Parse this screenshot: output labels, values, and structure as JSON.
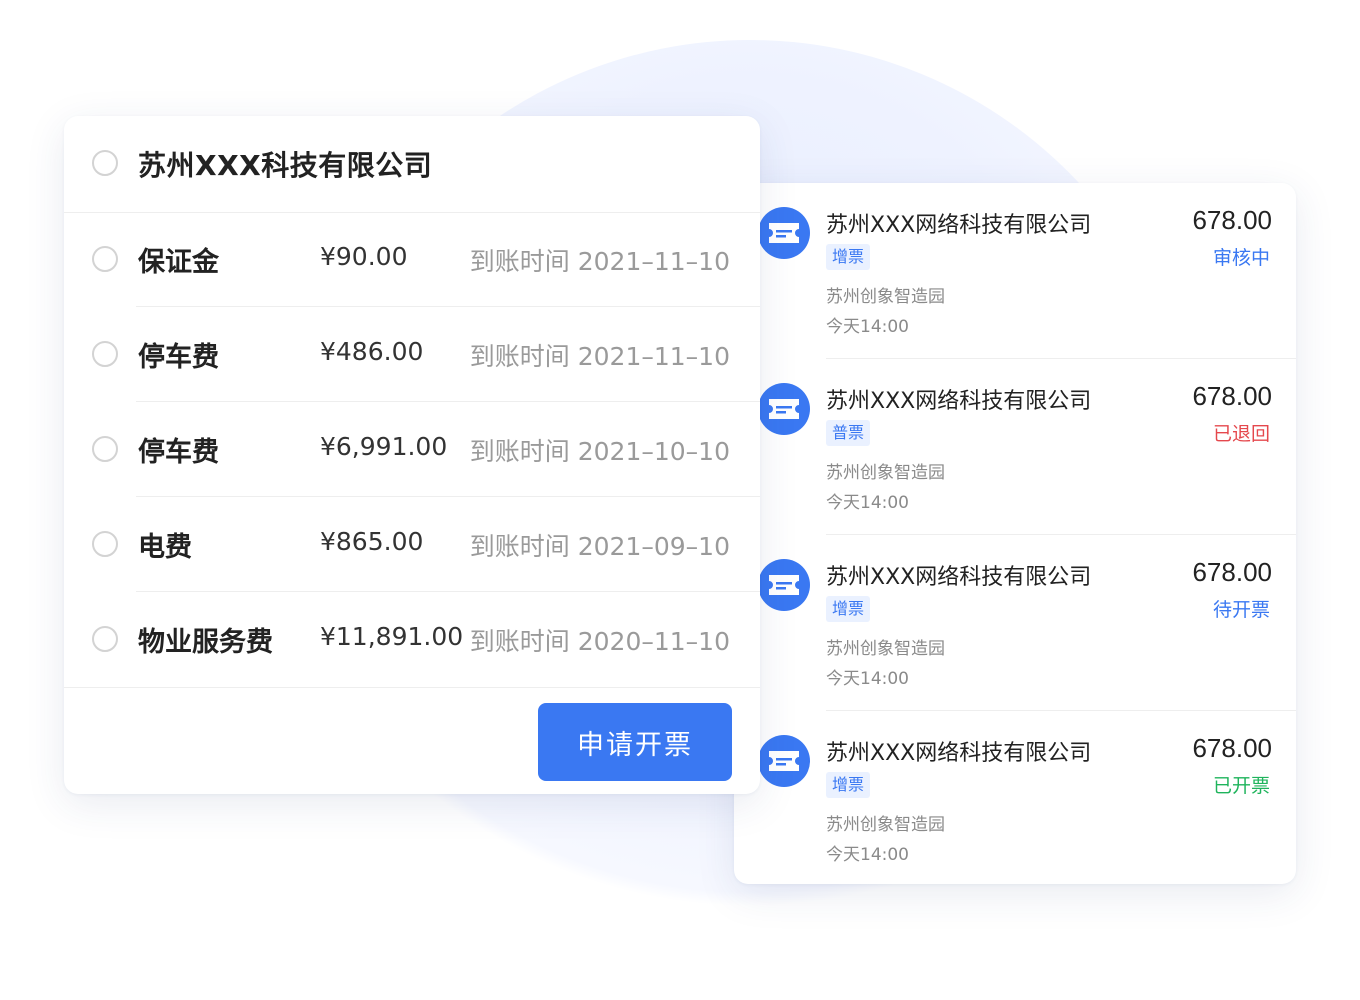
{
  "colors": {
    "primary": "#3a78f2",
    "status_reviewing": "#3a78f2",
    "status_returned": "#e5484d",
    "status_pending": "#3a78f2",
    "status_issued": "#1fb45c"
  },
  "left_card": {
    "company": "苏州XXX科技有限公司",
    "fees": [
      {
        "name": "保证金",
        "amount": "¥90.00",
        "date": "到账时间  2021–11–10"
      },
      {
        "name": "停车费",
        "amount": "¥486.00",
        "date": "到账时间  2021–11–10"
      },
      {
        "name": "停车费",
        "amount": "¥6,991.00",
        "date": "到账时间  2021–10–10"
      },
      {
        "name": "电费",
        "amount": "¥865.00",
        "date": "到账时间  2021–09–10"
      },
      {
        "name": "物业服务费",
        "amount": "¥11,891.00",
        "date": "到账时间  2020–11–10"
      }
    ],
    "apply_button": "申请开票"
  },
  "invoices": [
    {
      "icon": "ticket-icon",
      "company": "苏州XXX网络科技有限公司",
      "tag": "增票",
      "location": "苏州创象智造园",
      "time": "今天14:00",
      "amount": "678.00",
      "status": "审核中",
      "status_color": "#3a78f2"
    },
    {
      "icon": "ticket-icon",
      "company": "苏州XXX网络科技有限公司",
      "tag": "普票",
      "location": "苏州创象智造园",
      "time": "今天14:00",
      "amount": "678.00",
      "status": "已退回",
      "status_color": "#e5484d"
    },
    {
      "icon": "ticket-icon",
      "company": "苏州XXX网络科技有限公司",
      "tag": "增票",
      "location": "苏州创象智造园",
      "time": "今天14:00",
      "amount": "678.00",
      "status": "待开票",
      "status_color": "#3a78f2"
    },
    {
      "icon": "ticket-icon",
      "company": "苏州XXX网络科技有限公司",
      "tag": "增票",
      "location": "苏州创象智造园",
      "time": "今天14:00",
      "amount": "678.00",
      "status": "已开票",
      "status_color": "#1fb45c"
    }
  ]
}
